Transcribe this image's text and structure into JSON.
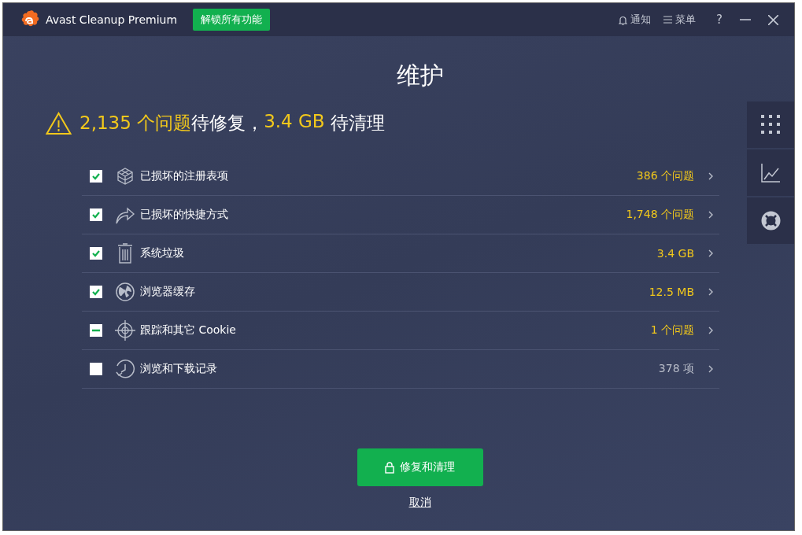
{
  "window": {
    "title": "Avast Cleanup Premium",
    "unlock_button": "解锁所有功能",
    "notifications": "通知",
    "menu": "菜单",
    "help": "?"
  },
  "heading": "维护",
  "summary": [
    {
      "text": "2,135 个问题",
      "highlight": true
    },
    {
      "text": "待修复，",
      "highlight": false
    },
    {
      "text": "3.4 GB",
      "highlight": true
    },
    {
      "text": " 待清理",
      "highlight": false
    }
  ],
  "items": [
    {
      "kind": "registry",
      "label": "已损坏的注册表项",
      "value": "386 个问题",
      "checked": true,
      "mixed": false,
      "warning": true
    },
    {
      "kind": "shortcut",
      "label": "已损坏的快捷方式",
      "value": "1,748 个问题",
      "checked": true,
      "mixed": false,
      "warning": true
    },
    {
      "kind": "trash",
      "label": "系统垃圾",
      "value": "3.4 GB",
      "checked": true,
      "mixed": false,
      "warning": true
    },
    {
      "kind": "browser",
      "label": "浏览器缓存",
      "value": "12.5 MB",
      "checked": true,
      "mixed": false,
      "warning": true
    },
    {
      "kind": "tracking",
      "label": "跟踪和其它 Cookie",
      "value": "1 个问题",
      "checked": false,
      "mixed": true,
      "warning": true
    },
    {
      "kind": "history",
      "label": "浏览和下载记录",
      "value": "378 项",
      "checked": false,
      "mixed": false,
      "warning": false
    }
  ],
  "primary_button": "修复和清理",
  "cancel_link": "取消"
}
